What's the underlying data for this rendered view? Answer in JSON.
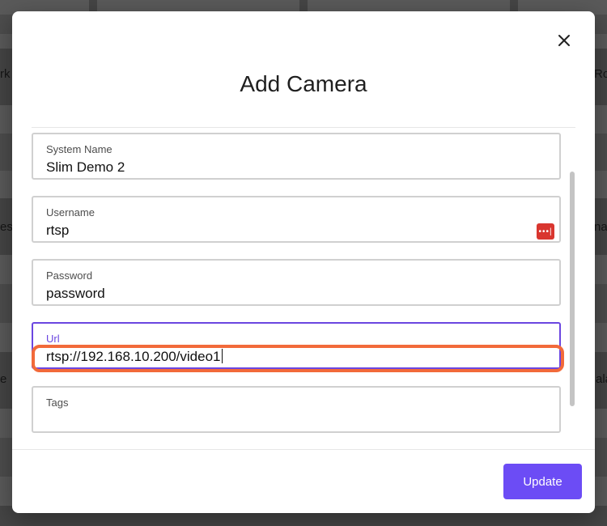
{
  "background": {
    "partial_labels": [
      "rk",
      "Ro",
      "est",
      "nar",
      "e",
      "ala"
    ]
  },
  "modal": {
    "title": "Add Camera",
    "fields": [
      {
        "label": "System Name",
        "value": "Slim Demo 2"
      },
      {
        "label": "Username",
        "value": "rtsp"
      },
      {
        "label": "Password",
        "value": "password"
      },
      {
        "label": "Url",
        "value": "rtsp://192.168.10.200/video1"
      },
      {
        "label": "Tags",
        "value": ""
      }
    ],
    "password_manager_icon": "key-dots-icon",
    "update_label": "Update"
  },
  "colors": {
    "accent": "#6b46e0",
    "button": "#6c4cf5",
    "highlight": "#f26a3a",
    "password_icon": "#d9362f"
  }
}
